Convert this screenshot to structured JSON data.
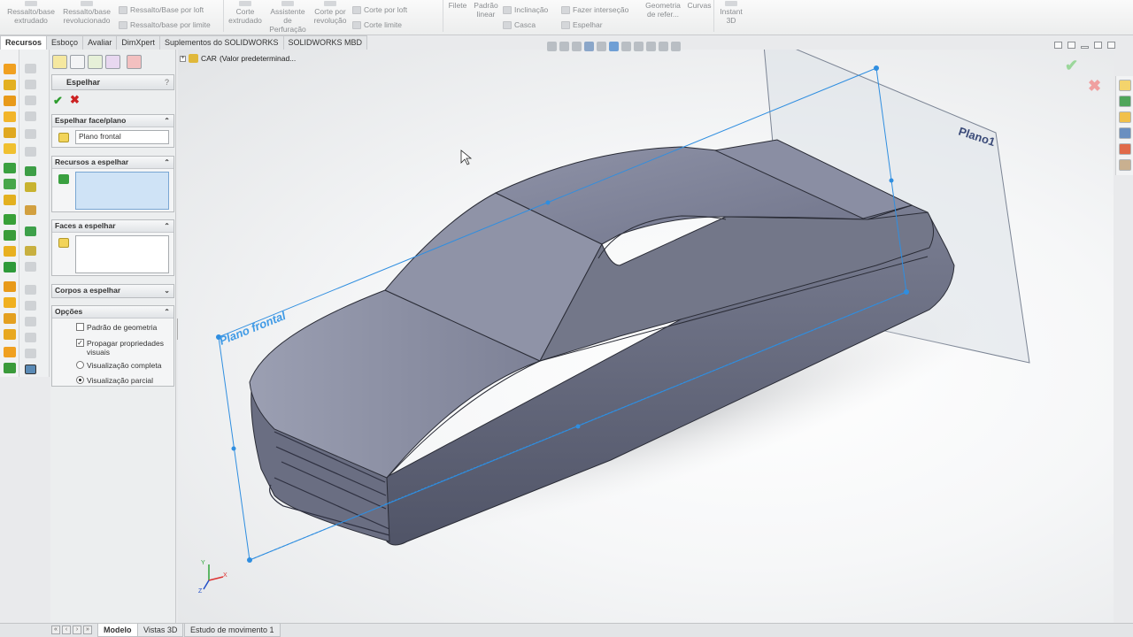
{
  "ribbon": {
    "buttons": [
      {
        "label": "Ressalto/base extrudado"
      },
      {
        "label": "Ressalto/base revolucionado"
      },
      {
        "label": "Ressalto/Base por loft"
      },
      {
        "label": "Ressalto/base por limite"
      },
      {
        "label": "Corte extrudado"
      },
      {
        "label": "Assistente de Perfuração"
      },
      {
        "label": "Corte por revolução"
      },
      {
        "label": "Corte por loft"
      },
      {
        "label": "Corte limite"
      },
      {
        "label": "Filete"
      },
      {
        "label": "Padrão linear"
      },
      {
        "label": "Inclinação"
      },
      {
        "label": "Casca"
      },
      {
        "label": "Fazer interseção"
      },
      {
        "label": "Espelhar"
      },
      {
        "label": "Geometria de refer..."
      },
      {
        "label": "Curvas"
      },
      {
        "label": "Instant 3D"
      }
    ]
  },
  "tabs": [
    "Recursos",
    "Esboço",
    "Avaliar",
    "DimXpert",
    "Suplementos do SOLIDWORKS",
    "SOLIDWORKS MBD"
  ],
  "propertyManager": {
    "title": "Espelhar",
    "help": "?",
    "sections": {
      "mirror_plane": {
        "header": "Espelhar face/plano",
        "value": "Plano frontal"
      },
      "features": {
        "header": "Recursos a espelhar"
      },
      "faces": {
        "header": "Faces a espelhar"
      },
      "bodies": {
        "header": "Corpos a espelhar"
      },
      "options": {
        "header": "Opções",
        "geometry_pattern": "Padrão de geometria",
        "propagate": "Propagar propriedades visuais",
        "full_preview": "Visualização completa",
        "partial_preview": "Visualização parcial"
      }
    }
  },
  "tree": {
    "root": "CAR",
    "config": "(Valor predeterminad..."
  },
  "viewport": {
    "planes": {
      "front": "Plano frontal",
      "plane1": "Plano1"
    },
    "triad": {
      "y": "Y",
      "x": "X",
      "z": "Z"
    }
  },
  "bottomTabs": [
    "Modelo",
    "Vistas 3D",
    "Estudo de movimento 1"
  ],
  "colors": {
    "accent": "#2f8ee0",
    "body": "#7a7f95",
    "ok": "#2e9d2e",
    "cancel": "#cc2222"
  }
}
